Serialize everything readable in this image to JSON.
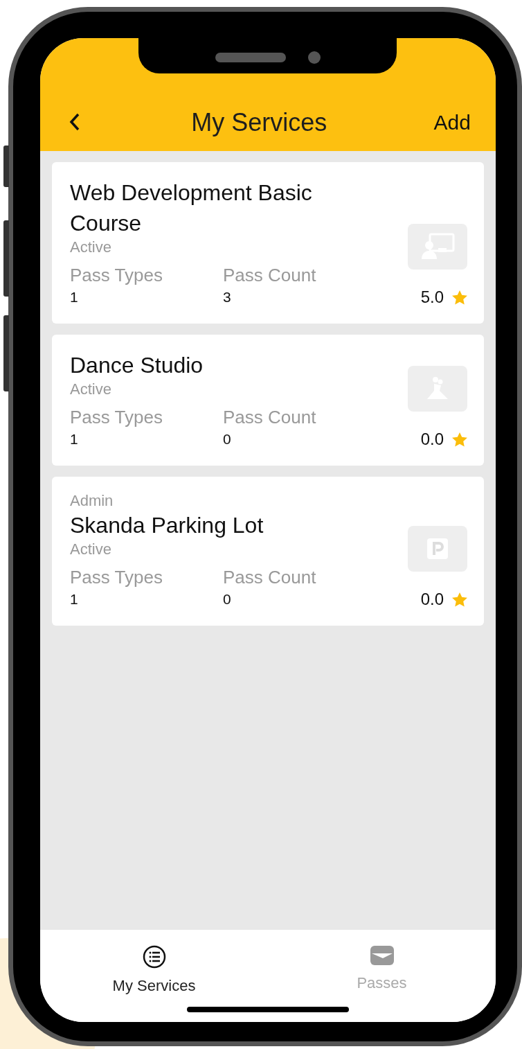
{
  "header": {
    "title": "My Services",
    "action": "Add"
  },
  "services": [
    {
      "kind": "presentation",
      "name": "Web Development Basic Course",
      "status": "Active",
      "pass_types_label": "Pass Types",
      "pass_types": "1",
      "pass_count_label": "Pass Count",
      "pass_count": "3",
      "rating": "5.0"
    },
    {
      "kind": "dance",
      "name": "Dance Studio",
      "status": "Active",
      "pass_types_label": "Pass Types",
      "pass_types": "1",
      "pass_count_label": "Pass Count",
      "pass_count": "0",
      "rating": "0.0"
    },
    {
      "kind": "parking",
      "role": "Admin",
      "name": "Skanda Parking Lot",
      "status": "Active",
      "pass_types_label": "Pass Types",
      "pass_types": "1",
      "pass_count_label": "Pass Count",
      "pass_count": "0",
      "rating": "0.0"
    }
  ],
  "tabs": [
    {
      "kind": "list",
      "label": "My Services",
      "selected": true
    },
    {
      "kind": "wallet",
      "label": "Passes",
      "selected": false
    }
  ]
}
